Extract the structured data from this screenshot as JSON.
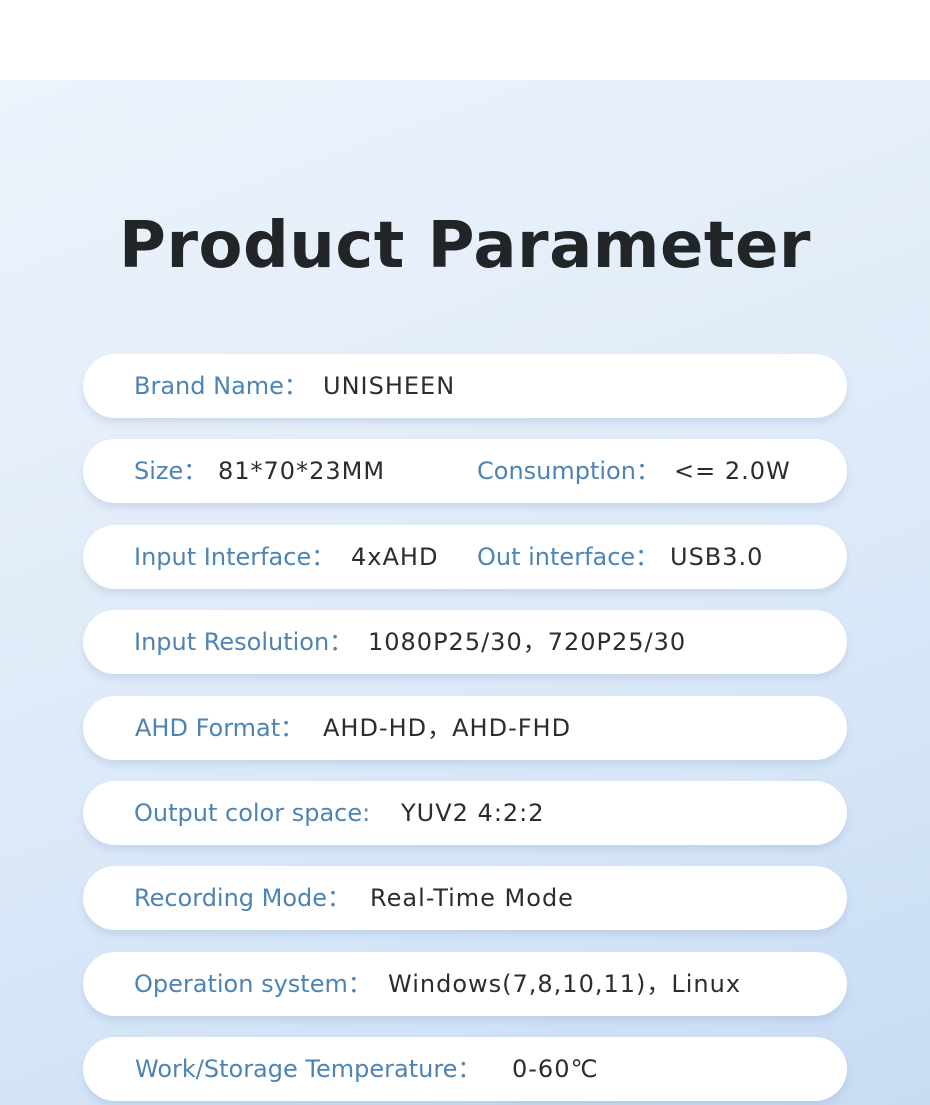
{
  "title": "Product Parameter",
  "params": {
    "brand": {
      "label": "Brand Name：",
      "value": "UNISHEEN"
    },
    "size": {
      "label": "Size：",
      "value": "81*70*23MM"
    },
    "consumption": {
      "label": "Consumption：",
      "value": "<= 2.0W"
    },
    "input_interface": {
      "label": "Input Interface：",
      "value": "4xAHD"
    },
    "out_interface": {
      "label": "Out interface：",
      "value": "USB3.0"
    },
    "input_resolution": {
      "label": "Input Resolution：",
      "value": "1080P25/30，720P25/30"
    },
    "ahd_format": {
      "label": "AHD Format：",
      "value": "AHD-HD，AHD-FHD"
    },
    "color_space": {
      "label": "Output color space:",
      "value": "YUV2 4:2:2"
    },
    "recording_mode": {
      "label": "Recording Mode：",
      "value": "Real-Time Mode"
    },
    "os": {
      "label": "Operation system：",
      "value": "Windows(7,8,10,11)，Linux"
    },
    "temperature": {
      "label": "Work/Storage Temperature：",
      "value": "0-60℃"
    }
  },
  "colors": {
    "label": "#4d84b3",
    "value": "#2a2d31",
    "title": "#222528",
    "background": "#dce9f8"
  }
}
